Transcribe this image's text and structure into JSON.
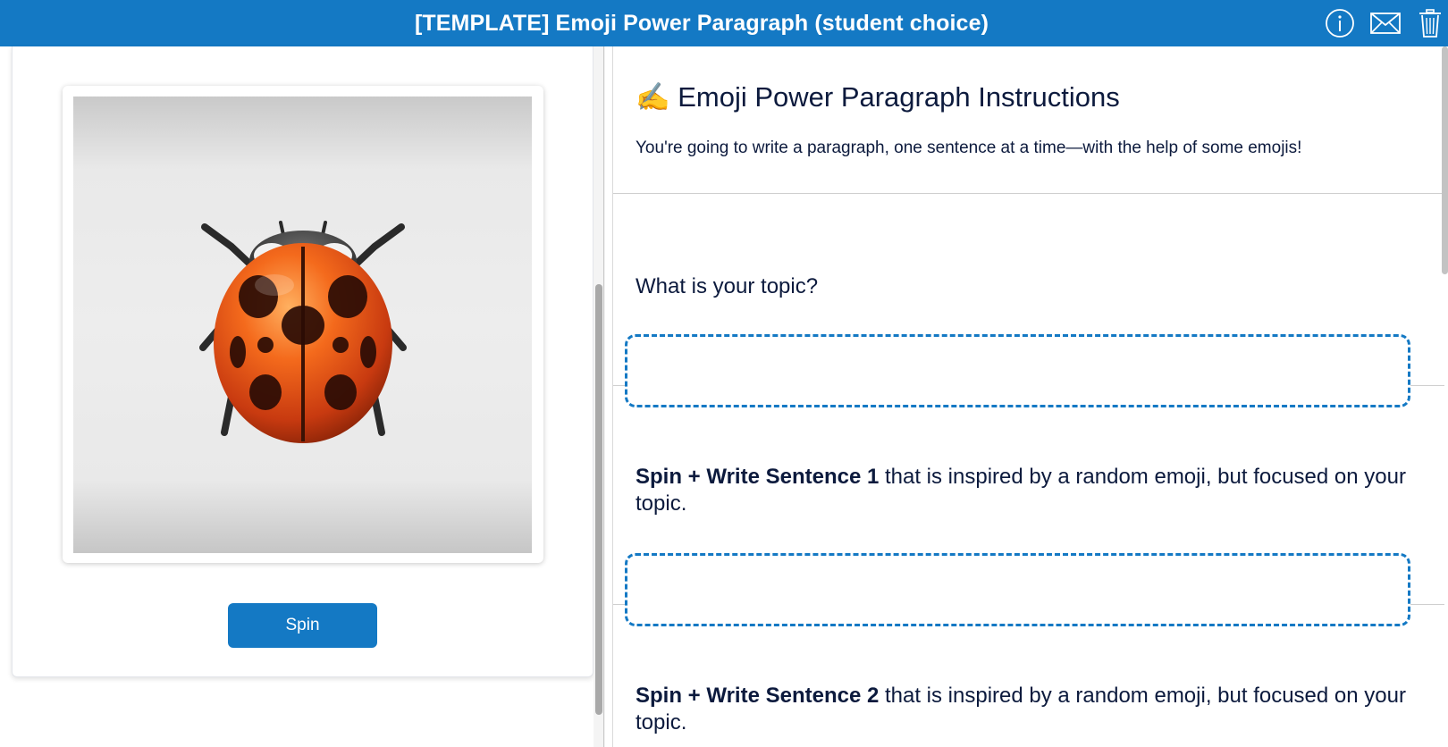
{
  "header": {
    "title": "[TEMPLATE] Emoji Power Paragraph (student choice)",
    "icons": [
      "info-icon",
      "mail-icon",
      "trash-icon"
    ],
    "background_color": "#1479c4"
  },
  "spinner": {
    "current_emoji": "ladybug",
    "spin_label": "Spin"
  },
  "instructions": {
    "title": "✍️ Emoji Power Paragraph Instructions",
    "description": "You're going to write a paragraph, one sentence at a time—with the help of some emojis!"
  },
  "questions": [
    {
      "bold": "",
      "text": "What is your topic?",
      "answer_value": ""
    },
    {
      "bold": "Spin + Write Sentence 1",
      "text": " that is inspired by a random emoji, but focused on your topic.",
      "answer_value": ""
    },
    {
      "bold": "Spin + Write Sentence 2",
      "text": " that is inspired by a random emoji, but focused on your topic.",
      "answer_value": ""
    }
  ],
  "colors": {
    "accent": "#1479c4",
    "text": "#0c1a3d"
  }
}
